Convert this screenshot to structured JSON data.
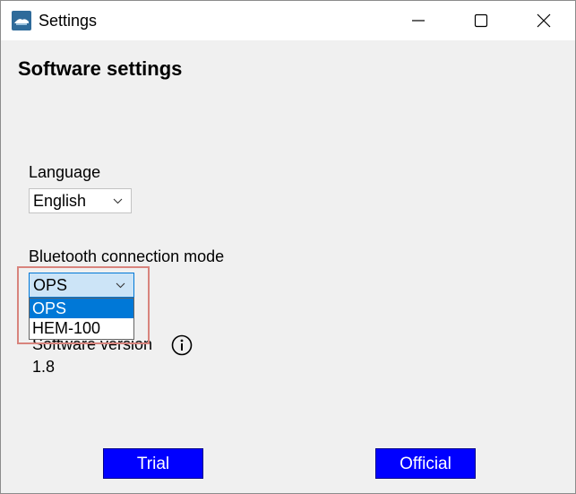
{
  "window": {
    "title": "Settings"
  },
  "page": {
    "heading": "Software settings"
  },
  "language": {
    "label": "Language",
    "selected": "English"
  },
  "bluetooth": {
    "label": "Bluetooth connection mode",
    "selected": "OPS",
    "options": [
      "OPS",
      "HEM-100"
    ]
  },
  "software": {
    "label": "Software version",
    "version": "1.8"
  },
  "buttons": {
    "trial": "Trial",
    "official": "Official"
  },
  "colors": {
    "button_bg": "#0000ff",
    "selection": "#0078d7",
    "highlight_box": "#d8847d"
  },
  "icons": {
    "app": "app-logo-icon",
    "minimize": "minimize-icon",
    "maximize": "maximize-icon",
    "close": "close-icon",
    "chevron": "chevron-down-icon",
    "info": "info-icon"
  }
}
